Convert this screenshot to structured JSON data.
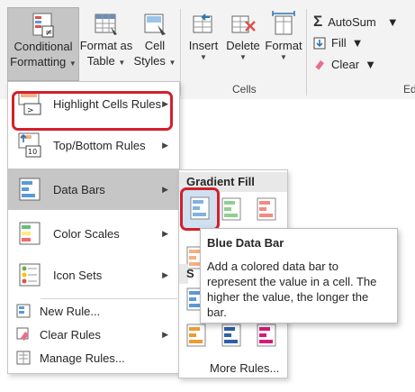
{
  "ribbon": {
    "conditional_formatting": {
      "line1": "Conditional",
      "line2": "Formatting"
    },
    "format_as_table": {
      "line1": "Format as",
      "line2": "Table"
    },
    "cell_styles": {
      "line1": "Cell",
      "line2": "Styles"
    },
    "insert": "Insert",
    "delete": "Delete",
    "format": "Format",
    "cells_group_label": "Cells",
    "editing_group_label": "Editi",
    "autosum": "AutoSum",
    "fill": "Fill",
    "clear": "Clear"
  },
  "menu": {
    "items": [
      {
        "label": "Highlight Cells Rules",
        "icon": "highlight-cells-icon",
        "has_submenu": true
      },
      {
        "label": "Top/Bottom Rules",
        "icon": "top-bottom-icon",
        "has_submenu": true
      },
      {
        "label": "Data Bars",
        "icon": "data-bars-icon",
        "has_submenu": true
      },
      {
        "label": "Color Scales",
        "icon": "color-scales-icon",
        "has_submenu": true
      },
      {
        "label": "Icon Sets",
        "icon": "icon-sets-icon",
        "has_submenu": true
      }
    ],
    "small_items": [
      {
        "label": "New Rule...",
        "icon": "new-rule-icon"
      },
      {
        "label": "Clear Rules",
        "icon": "clear-rules-icon"
      },
      {
        "label": "Manage Rules...",
        "icon": "manage-rules-icon"
      }
    ]
  },
  "submenu": {
    "gradient_header": "Gradient Fill",
    "solid_header_partial": "S",
    "more_rules": "More Rules..."
  },
  "tooltip": {
    "title": "Blue Data Bar",
    "body": "Add a colored data bar to represent the value in a cell. The higher the value, the longer the bar."
  },
  "colors": {
    "highlight_red": "#d2202c",
    "bar_blue": "#5b9bd5",
    "bar_green": "#70ad47",
    "bar_red": "#e74c3c",
    "bar_orange": "#ed9b33",
    "bar_purple": "#7030a0",
    "bar_magenta": "#d81b7a"
  }
}
